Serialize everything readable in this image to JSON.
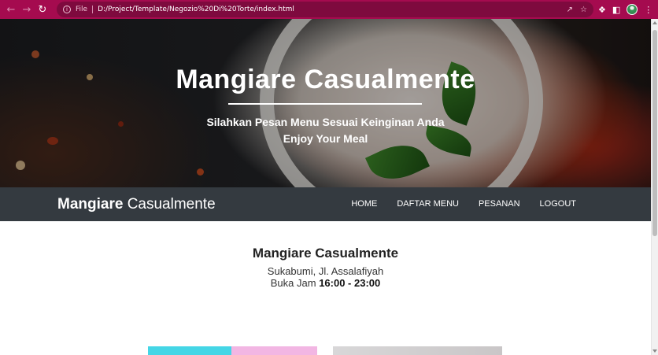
{
  "browser": {
    "file_label": "File",
    "url": "D:/Project/Template/Negozio%20Di%20Torte/index.html",
    "accent": "#a50b4f"
  },
  "hero": {
    "title": "Mangiare Casualmente",
    "subtitle": "Silahkan Pesan Menu Sesuai Keinginan Anda",
    "tagline": "Enjoy Your Meal"
  },
  "navbar": {
    "brand_bold": "Mangiare",
    "brand_light": "Casualmente",
    "links": [
      "HOME",
      "DAFTAR MENU",
      "PESANAN",
      "LOGOUT"
    ],
    "background": "#343a40"
  },
  "info": {
    "name": "Mangiare Casualmente",
    "address": "Sukabumi, Jl. Assalafiyah",
    "hours_label": "Buka Jam",
    "hours_value": "16:00 - 23:00"
  }
}
